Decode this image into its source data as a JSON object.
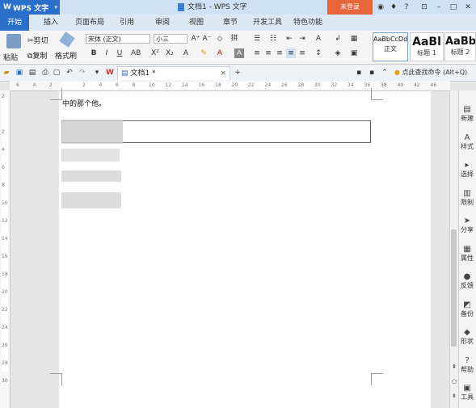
{
  "app": {
    "name": "WPS 文字",
    "doc_title": "文档1 - WPS 文字",
    "login": "未登录"
  },
  "tabs": [
    "开始",
    "插入",
    "页面布局",
    "引用",
    "审阅",
    "视图",
    "章节",
    "开发工具",
    "特色功能"
  ],
  "ribbon": {
    "paste": "粘贴",
    "cut": "剪切",
    "copy": "复制",
    "format_painter": "格式刷",
    "font_name": "宋体 (正文)",
    "font_size": "小三",
    "styles": [
      {
        "sample": "AaBbCcDd",
        "label": "正文"
      },
      {
        "sample": "AaBl",
        "label": "标题 1"
      },
      {
        "sample": "AaBb",
        "label": "标题 2"
      }
    ]
  },
  "doctab": {
    "name": "文档1 *",
    "search": "点此查找命令 (Alt+Q)"
  },
  "document": {
    "line1": "中的那个他。"
  },
  "ruler": {
    "h_ticks": [
      "6",
      "4",
      "2",
      "",
      "2",
      "4",
      "6",
      "8",
      "10",
      "12",
      "14",
      "16",
      "18",
      "20",
      "22",
      "24",
      "26",
      "28",
      "30",
      "32",
      "34",
      "36",
      "38",
      "40",
      "42",
      "46"
    ],
    "v_ticks": [
      "2",
      "",
      "2",
      "4",
      "6",
      "8",
      "10",
      "12",
      "14",
      "16",
      "18",
      "20",
      "22",
      "24",
      "26",
      "28",
      "30"
    ]
  },
  "sidebar": [
    {
      "icon": "new-doc-icon",
      "label": "新建"
    },
    {
      "icon": "style-icon",
      "label": "样式"
    },
    {
      "icon": "select-icon",
      "label": "选择"
    },
    {
      "icon": "restrict-icon",
      "label": "限制"
    },
    {
      "icon": "share-icon",
      "label": "分享"
    },
    {
      "icon": "properties-icon",
      "label": "属性"
    },
    {
      "icon": "feedback-icon",
      "label": "反馈"
    },
    {
      "icon": "backup-icon",
      "label": "备份"
    },
    {
      "icon": "shape-icon",
      "label": "形状"
    },
    {
      "icon": "help-icon",
      "label": "帮助"
    },
    {
      "icon": "toolbox-icon",
      "label": "工具"
    }
  ],
  "colors": {
    "accent": "#2a6fc9",
    "login": "#e8643a"
  }
}
